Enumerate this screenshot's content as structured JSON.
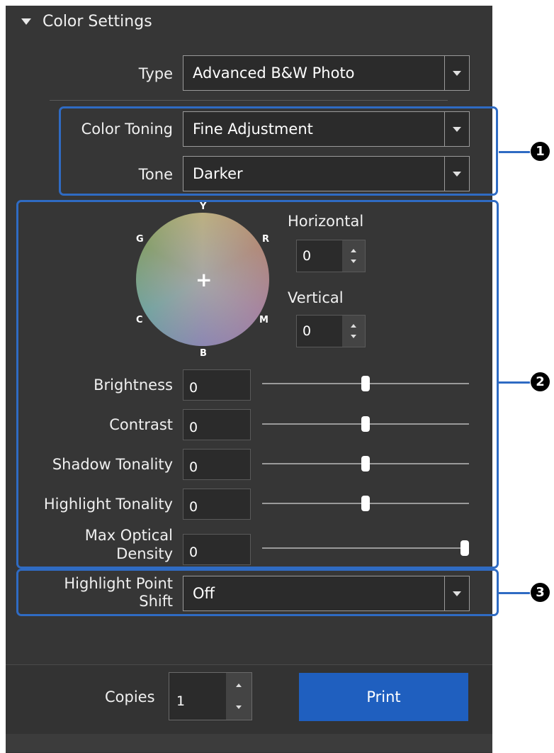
{
  "section": {
    "title": "Color Settings"
  },
  "type_field": {
    "label": "Type",
    "value": "Advanced B&W Photo"
  },
  "color_toning": {
    "label": "Color Toning",
    "value": "Fine Adjustment"
  },
  "tone": {
    "label": "Tone",
    "value": "Darker"
  },
  "color_wheel": {
    "labels": {
      "y": "Y",
      "r": "R",
      "m": "M",
      "b": "B",
      "c": "C",
      "g": "G"
    },
    "horizontal": {
      "label": "Horizontal",
      "value": "0"
    },
    "vertical": {
      "label": "Vertical",
      "value": "0"
    }
  },
  "sliders": [
    {
      "label": "Brightness",
      "value": "0",
      "level": 0.5
    },
    {
      "label": "Contrast",
      "value": "0",
      "level": 0.5
    },
    {
      "label": "Shadow Tonality",
      "value": "0",
      "level": 0.5
    },
    {
      "label": "Highlight Tonality",
      "value": "0",
      "level": 0.5
    },
    {
      "label_line1": "Max Optical",
      "label_line2": "Density",
      "value": "0",
      "level": 1.0
    }
  ],
  "highlight_point_shift": {
    "label_line1": "Highlight Point",
    "label_line2": "Shift",
    "value": "Off"
  },
  "copies": {
    "label": "Copies",
    "value": "1"
  },
  "print_button": {
    "label": "Print"
  },
  "callouts": [
    "1",
    "2",
    "3"
  ],
  "colors": {
    "panel": "#363636",
    "accent": "#2f6bc3",
    "print": "#1f5fbf"
  }
}
